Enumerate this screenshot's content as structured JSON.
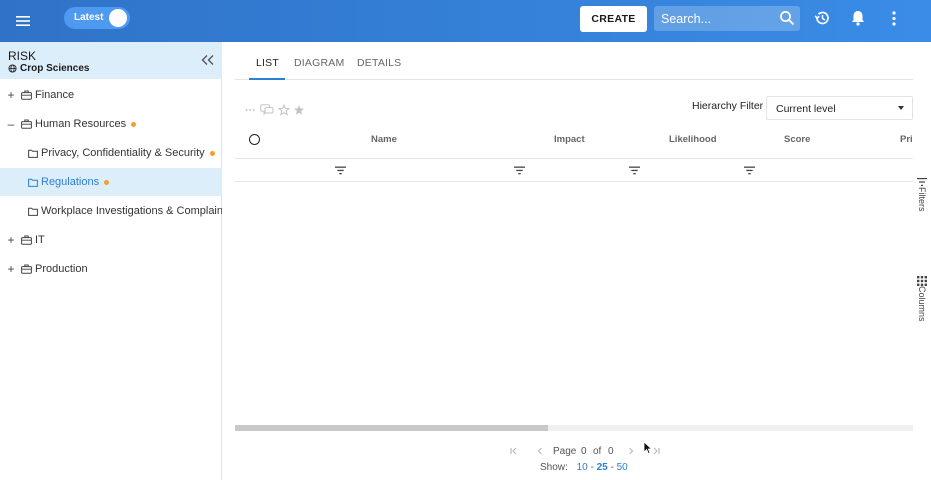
{
  "topbar": {
    "version_label": "Latest",
    "create_label": "CREATE",
    "search_placeholder": "Search..."
  },
  "sidebar": {
    "title": "RISK",
    "subtitle": "Crop Sciences",
    "items": [
      {
        "label": "Finance",
        "expander": "+",
        "level": 0,
        "dot": false,
        "selected": false
      },
      {
        "label": "Human Resources",
        "expander": "–",
        "level": 0,
        "dot": true,
        "selected": false
      },
      {
        "label": "Privacy, Confidentiality & Security",
        "expander": "",
        "level": 1,
        "dot": true,
        "selected": false
      },
      {
        "label": "Regulations",
        "expander": "",
        "level": 1,
        "dot": true,
        "selected": true
      },
      {
        "label": "Workplace Investigations & Complaints",
        "expander": "",
        "level": 1,
        "dot": false,
        "selected": false
      },
      {
        "label": "IT",
        "expander": "+",
        "level": 0,
        "dot": false,
        "selected": false
      },
      {
        "label": "Production",
        "expander": "+",
        "level": 0,
        "dot": false,
        "selected": false
      }
    ]
  },
  "tabs": [
    {
      "label": "LIST",
      "active": true
    },
    {
      "label": "DIAGRAM",
      "active": false
    },
    {
      "label": "DETAILS",
      "active": false
    }
  ],
  "toolbar": {
    "hierarchy_filter_label": "Hierarchy Filter",
    "hierarchy_filter_value": "Current level"
  },
  "grid": {
    "columns": [
      "Name",
      "Impact",
      "Likelihood",
      "Score",
      "Pri"
    ]
  },
  "side_tabs": {
    "filters_label": "Filters",
    "columns_label": "Columns"
  },
  "pager": {
    "page_label": "Page",
    "page_current": "0",
    "of_label": "of",
    "page_total": "0",
    "show_label": "Show:",
    "size_options": [
      "10",
      "25",
      "50"
    ],
    "selected_size": "25"
  },
  "colors": {
    "topbar": "#3a8ce6",
    "accent": "#2c7fd6",
    "selected_bg": "#ddeefb",
    "dot": "#f59e2f"
  }
}
